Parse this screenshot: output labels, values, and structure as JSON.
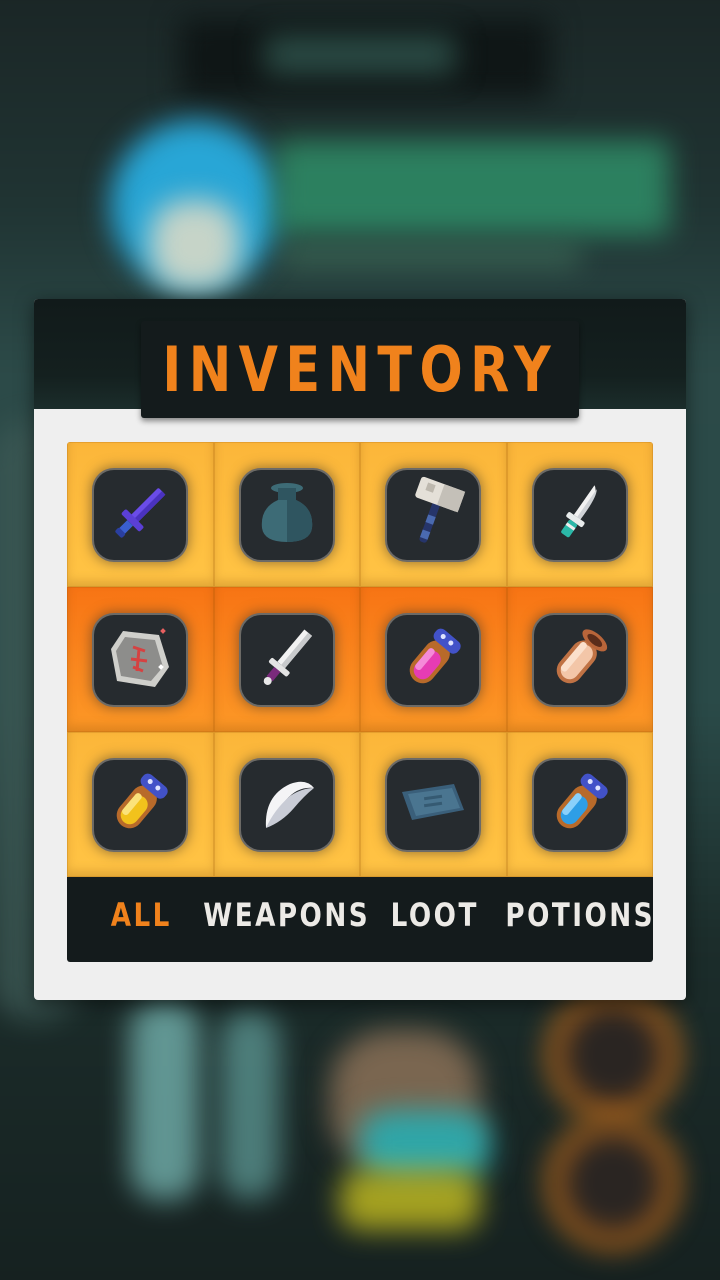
{
  "inventory": {
    "title": "INVENTORY",
    "tabs": [
      {
        "label": "ALL",
        "active": true
      },
      {
        "label": "WEAPONS",
        "active": false
      },
      {
        "label": "LOOT",
        "active": false
      },
      {
        "label": "POTIONS",
        "active": false
      }
    ],
    "items": [
      {
        "icon": "purple-sword-icon"
      },
      {
        "icon": "dark-jar-icon"
      },
      {
        "icon": "stone-hammer-icon"
      },
      {
        "icon": "teal-dagger-icon"
      },
      {
        "icon": "rune-stone-icon"
      },
      {
        "icon": "steel-sword-icon"
      },
      {
        "icon": "pink-potion-icon"
      },
      {
        "icon": "empty-vial-icon"
      },
      {
        "icon": "yellow-potion-icon"
      },
      {
        "icon": "white-feather-icon"
      },
      {
        "icon": "scroll-map-icon"
      },
      {
        "icon": "blue-potion-icon"
      }
    ]
  },
  "colors": {
    "accent": "#f0821c",
    "tab_text": "#eceae6",
    "panel_dark": "#141b1c",
    "cell_light": "#ffbe3f",
    "cell_dark": "#fb8a20",
    "slot": "#262b2f"
  }
}
